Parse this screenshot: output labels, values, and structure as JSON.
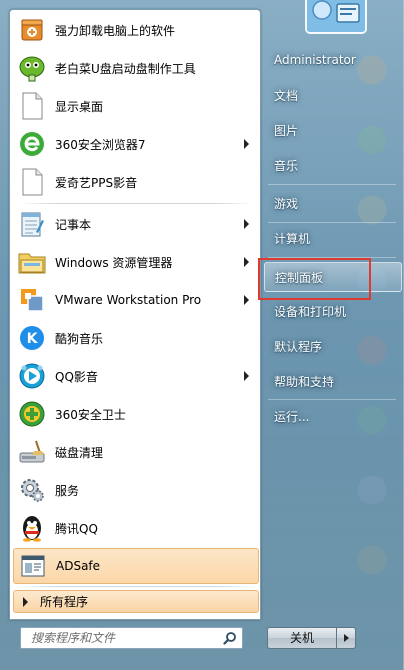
{
  "left_menu": {
    "items": [
      {
        "label": "强力卸载电脑上的软件",
        "icon": "uninstaller-icon",
        "arrow": false
      },
      {
        "label": "老白菜U盘启动盘制作工具",
        "icon": "cabbage-usb-icon",
        "arrow": false
      },
      {
        "label": "显示桌面",
        "icon": "blank-document-icon",
        "arrow": false
      },
      {
        "label": "360安全浏览器7",
        "icon": "360-browser-icon",
        "arrow": true
      },
      {
        "label": "爱奇艺PPS影音",
        "icon": "blank-document-icon",
        "arrow": false
      },
      {
        "label": "记事本",
        "icon": "notepad-icon",
        "arrow": true
      },
      {
        "label": "Windows 资源管理器",
        "icon": "folder-explorer-icon",
        "arrow": true
      },
      {
        "label": "VMware Workstation Pro",
        "icon": "vmware-icon",
        "arrow": true
      },
      {
        "label": "酷狗音乐",
        "icon": "kugou-icon",
        "arrow": false
      },
      {
        "label": "QQ影音",
        "icon": "qq-player-icon",
        "arrow": true
      },
      {
        "label": "360安全卫士",
        "icon": "360-safe-icon",
        "arrow": false
      },
      {
        "label": "磁盘清理",
        "icon": "disk-cleanup-icon",
        "arrow": false
      },
      {
        "label": "服务",
        "icon": "services-gear-icon",
        "arrow": false
      },
      {
        "label": "腾讯QQ",
        "icon": "qq-penguin-icon",
        "arrow": false
      },
      {
        "label": "ADSafe",
        "icon": "adsafe-icon",
        "arrow": false
      }
    ],
    "all_programs": "所有程序",
    "search_placeholder": "搜索程序和文件"
  },
  "right_menu": {
    "items": [
      {
        "label": "Administrator"
      },
      {
        "label": "文档"
      },
      {
        "label": "图片"
      },
      {
        "label": "音乐"
      },
      {
        "label": "游戏"
      },
      {
        "label": "计算机"
      },
      {
        "label": "控制面板"
      },
      {
        "label": "设备和打印机"
      },
      {
        "label": "默认程序"
      },
      {
        "label": "帮助和支持"
      },
      {
        "label": "运行..."
      }
    ],
    "highlighted": "控制面板"
  },
  "shutdown": {
    "label": "关机"
  },
  "colors": {
    "highlight_box": "#e0392f",
    "hover_orange": "#fbd7a8"
  }
}
